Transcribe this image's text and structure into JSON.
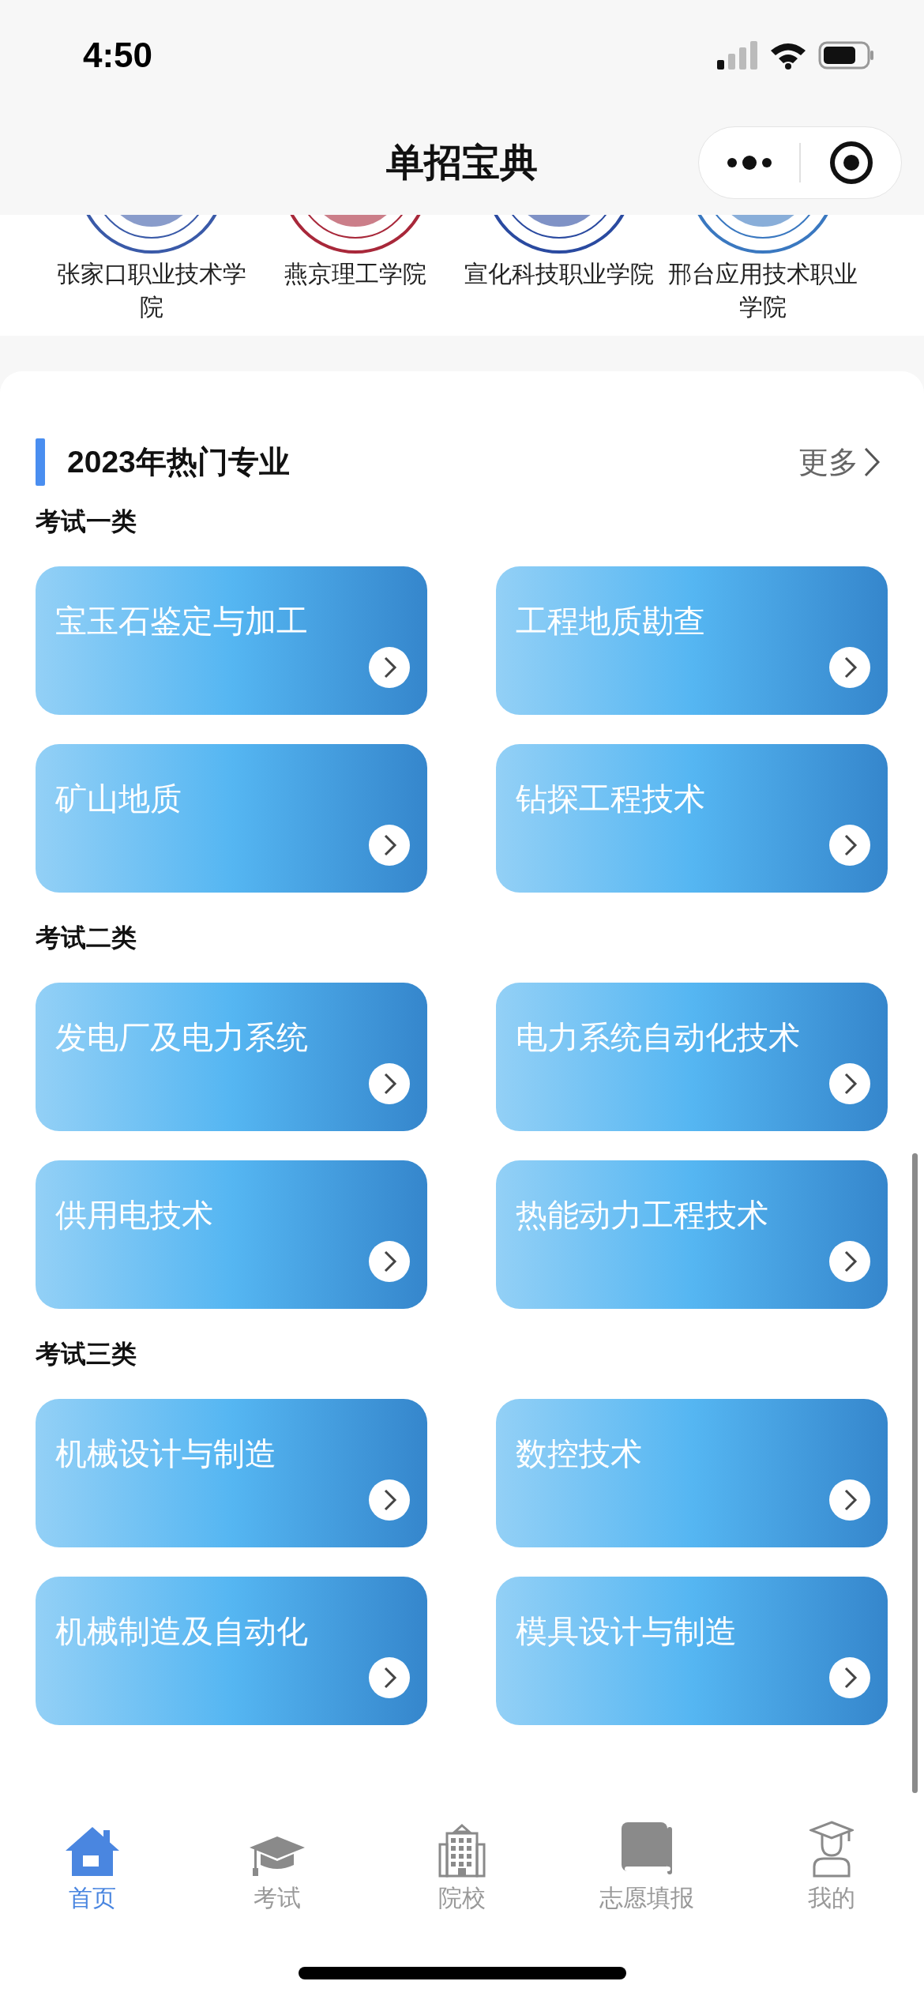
{
  "status_bar": {
    "time": "4:50"
  },
  "nav_bar": {
    "title": "单招宝典"
  },
  "colleges": [
    {
      "name": "张家口职业技术学院",
      "color": "#3a5aa8"
    },
    {
      "name": "燕京理工学院",
      "color": "#a8283a"
    },
    {
      "name": "宣化科技职业学院",
      "color": "#2a4aa0"
    },
    {
      "name": "邢台应用技术职业学院",
      "color": "#3a78c0"
    }
  ],
  "hot_majors": {
    "title": "2023年热门专业",
    "more": "更多",
    "groups": [
      {
        "label": "考试一类",
        "items": [
          "宝玉石鉴定与加工",
          "工程地质勘查",
          "矿山地质",
          "钻探工程技术"
        ]
      },
      {
        "label": "考试二类",
        "items": [
          "发电厂及电力系统",
          "电力系统自动化技术",
          "供用电技术",
          "热能动力工程技术"
        ]
      },
      {
        "label": "考试三类",
        "items": [
          "机械设计与制造",
          "数控技术",
          "机械制造及自动化",
          "模具设计与制造"
        ]
      }
    ]
  },
  "tab_bar": [
    {
      "label": "首页",
      "kind": "home",
      "selected": true
    },
    {
      "label": "考试",
      "kind": "exam",
      "selected": false
    },
    {
      "label": "院校",
      "kind": "school",
      "selected": false
    },
    {
      "label": "志愿填报",
      "kind": "apply",
      "selected": false
    },
    {
      "label": "我的",
      "kind": "me",
      "selected": false
    }
  ]
}
